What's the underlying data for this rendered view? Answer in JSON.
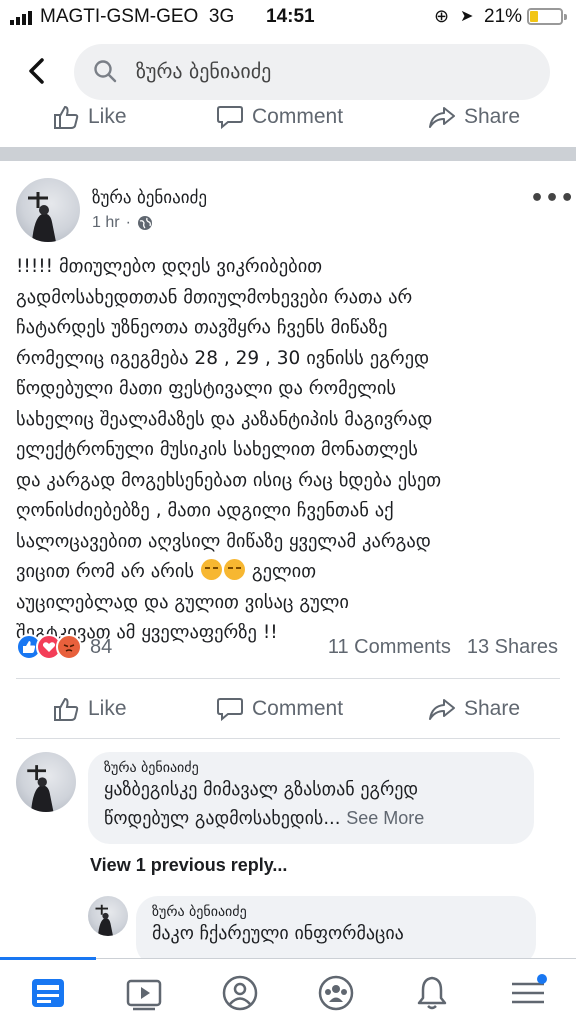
{
  "status_bar": {
    "carrier": "MAGTI-GSM-GEO",
    "network": "3G",
    "time": "14:51",
    "battery_percent": "21%",
    "battery_level": 0.21,
    "battery_color": "#f2c515"
  },
  "search": {
    "query": "ზურა ბენიაიძე",
    "back_icon": "chevron-left-icon",
    "search_icon": "magnifier-icon"
  },
  "actions": {
    "like": "Like",
    "comment": "Comment",
    "share": "Share"
  },
  "post": {
    "author": "ზურა ბენიაიძე",
    "time": "1 hr",
    "separator": "·",
    "privacy_icon": "globe-icon",
    "more_icon": "•••",
    "body_lines": [
      "!!!!! მთიულებო დღეს ვიკრიბებით",
      "გადმოსახედთთან მთიულმოხევები  რათა არ",
      "ჩატარდეს უზნეოთა თავშყრა ჩვენს მიწაზე",
      "რომელიც იგეგმება 28 , 29 , 30 ივნისს ეგრედ",
      "წოდებული მათი ფესტივალი და რომელის",
      "სახელიც შეალამაზეს და კაზანტიპის მაგივრად",
      "ელექტრონული მუსიკის სახელით მონათლეს",
      "და კარგად მოგეხსენებათ ისიც  რაც ხდება ესეთ",
      "ღონისძიებებზე , მათი ადგილი ჩვენთან აქ",
      "სალოცავებით აღვსილ მიწაზე ყველამ  კარგად",
      "ვიცით  რომ არ არის",
      " გელით",
      "აუცილებლად და გულით ვისაც გული",
      "შეგტკივათ ამ ყველაფერზე !!"
    ],
    "reaction_count": "84",
    "comments_count": "11 Comments",
    "shares_count": "13 Shares",
    "reaction_colors": {
      "like": "#1877f2",
      "love": "#f33e58",
      "angry": "#e8603c"
    }
  },
  "comments": [
    {
      "author": "ზურა ბენიაიძე",
      "line1": "ყაზბეგისკე მიმავალ გზასთან ეგრედ",
      "line2": "წოდებულ გადმოსახედის...",
      "see_more": "See More"
    }
  ],
  "view_replies": "View 1 previous reply...",
  "reply": {
    "author": "ზურა ბენიაიძე",
    "text": "მაკო ჩქარეული ინფორმაცია"
  },
  "tab_bar": {
    "accent_color": "#1877f2",
    "tabs": [
      "news-feed-icon",
      "watch-icon",
      "profile-icon",
      "groups-icon",
      "notifications-icon",
      "menu-icon"
    ]
  }
}
